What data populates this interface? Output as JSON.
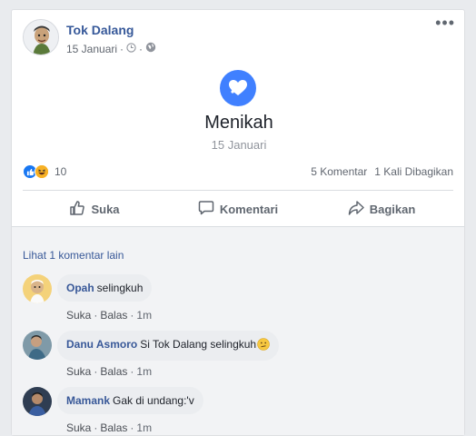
{
  "post": {
    "author": "Tok Dalang",
    "date": "15 Januari",
    "date_sep": "·",
    "more_icon": "•••"
  },
  "event": {
    "title": "Menikah",
    "date": "15 Januari",
    "icon": "heart-icon"
  },
  "stats": {
    "reactions_count": "10",
    "comments": "5 Komentar",
    "shares": "1 Kali Dibagikan"
  },
  "actions": {
    "like": "Suka",
    "comment": "Komentari",
    "share": "Bagikan"
  },
  "comments_section": {
    "view_more": "Lihat 1 komentar lain",
    "items": [
      {
        "name": "Opah",
        "text": "selingkuh",
        "like": "Suka",
        "reply": "Balas",
        "time": "1m",
        "sep": "·"
      },
      {
        "name": "Danu Asmoro",
        "text": "Si Tok Dalang selingkuh",
        "like": "Suka",
        "reply": "Balas",
        "time": "1m",
        "sep": "·"
      },
      {
        "name": "Mamank",
        "text": "Gak di undang:'v",
        "like": "Suka",
        "reply": "Balas",
        "time": "1m",
        "sep": "·"
      }
    ]
  },
  "colors": {
    "brand_link": "#365899",
    "event_icon_bg": "#4080ff",
    "like_blue": "#1877f2",
    "haha_yellow": "#f7b125"
  }
}
